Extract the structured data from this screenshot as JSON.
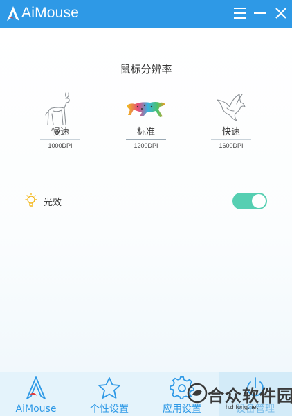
{
  "app": {
    "title": "AiMouse"
  },
  "titlebar": {
    "icons": [
      "menu-icon",
      "minimize-icon",
      "close-icon"
    ]
  },
  "resolution": {
    "title": "鼠标分辨率",
    "options": [
      {
        "icon": "deer-icon",
        "label": "慢速",
        "dpi": "1000DPI"
      },
      {
        "icon": "cheetah-icon",
        "label": "标准",
        "dpi": "1200DPI"
      },
      {
        "icon": "eagle-icon",
        "label": "快速",
        "dpi": "1600DPI"
      }
    ],
    "selected_index": 1
  },
  "lighting": {
    "icon": "light-bulb-icon",
    "label": "光效",
    "enabled": true
  },
  "nav": {
    "items": [
      {
        "icon": "aimouse-logo-icon",
        "label": "AiMouse"
      },
      {
        "icon": "star-icon",
        "label": "个性设置"
      },
      {
        "icon": "gear-icon",
        "label": "应用设置"
      },
      {
        "icon": "power-icon",
        "label": "设备管理"
      }
    ]
  },
  "watermark": {
    "text": "合众软件园",
    "url": "hzhfong.net"
  },
  "colors": {
    "accent": "#2e99e6",
    "toggle_on": "#56cfb2",
    "nav_background": "#e4f3fb"
  }
}
